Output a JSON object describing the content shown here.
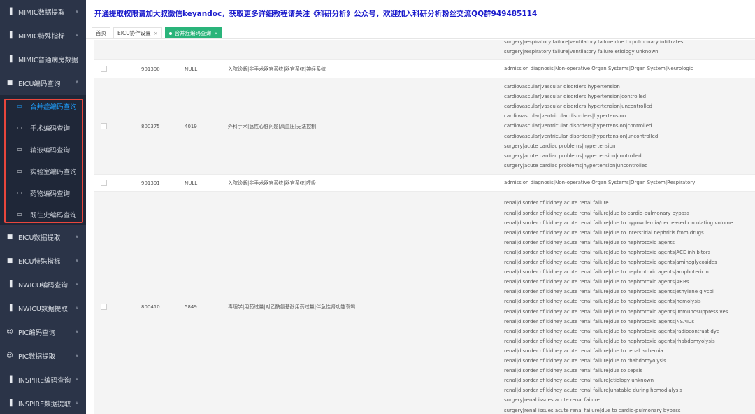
{
  "sidebar": {
    "items": [
      {
        "label": "MIMIC数据提取",
        "icon": "bar-chart-icon",
        "chevron": "∨"
      },
      {
        "label": "MIMIC特殊指标",
        "icon": "bar-chart-icon",
        "chevron": "∨"
      },
      {
        "label": "MIMIC普通病房数据",
        "icon": "bar-chart-icon",
        "chevron": "∨"
      },
      {
        "label": "EICU编码查询",
        "icon": "folder-icon",
        "chevron": "∧"
      }
    ],
    "sub_items": [
      {
        "label": "合并症编码查询",
        "icon": "monitor-icon"
      },
      {
        "label": "手术编码查询",
        "icon": "monitor-icon"
      },
      {
        "label": "输液编码查询",
        "icon": "monitor-icon"
      },
      {
        "label": "实验室编码查询",
        "icon": "monitor-icon"
      },
      {
        "label": "药物编码查询",
        "icon": "monitor-icon"
      },
      {
        "label": "既往史编码查询",
        "icon": "monitor-icon"
      }
    ],
    "items_after": [
      {
        "label": "EICU数据提取",
        "icon": "folder-icon",
        "chevron": "∨"
      },
      {
        "label": "EICU特殊指标",
        "icon": "folder-icon",
        "chevron": "∨"
      },
      {
        "label": "NWICU编码查询",
        "icon": "bar-chart-icon",
        "chevron": "∨"
      },
      {
        "label": "NWICU数据提取",
        "icon": "bar-chart-icon",
        "chevron": "∨"
      },
      {
        "label": "PIC编码查询",
        "icon": "baby-icon",
        "chevron": "∨"
      },
      {
        "label": "PIC数据提取",
        "icon": "baby-icon",
        "chevron": "∨"
      },
      {
        "label": "INSPIRE编码查询",
        "icon": "bar-chart-icon",
        "chevron": "∨"
      },
      {
        "label": "INSPIRE数据提取",
        "icon": "bar-chart-icon",
        "chevron": "∨"
      }
    ]
  },
  "banner": "开通提取权限请加大叔微信keyandoc，获取更多详细教程请关注《科研分析》公众号，欢迎加入科研分析粉丝交流QQ群949485114",
  "tabs": {
    "home": "首页",
    "eicu_settings": "EICU协作设置",
    "active": "合并症编码查询",
    "close": "×"
  },
  "rows": [
    {
      "id": "",
      "code": "",
      "cn": "",
      "en": [
        "surgery|respiratory failure|ventilatory failure|due to pulmonary infiltrates",
        "surgery|respiratory failure|ventilatory failure|etiology unknown"
      ]
    },
    {
      "id": "901390",
      "code": "NULL",
      "cn": "入院诊断|非手术器官系统|器官系统|神经系统",
      "en": [
        "admission diagnosis|Non-operative Organ Systems|Organ System|Neurologic"
      ]
    },
    {
      "id": "800375",
      "code": "4019",
      "cn": "外科手术|急性心脏问题|高血压|无法控制",
      "en": [
        "cardiovascular|vascular disorders|hypertension",
        "cardiovascular|vascular disorders|hypertension|controlled",
        "cardiovascular|vascular disorders|hypertension|uncontrolled",
        "cardiovascular|ventricular disorders|hypertension",
        "cardiovascular|ventricular disorders|hypertension|controlled",
        "cardiovascular|ventricular disorders|hypertension|uncontrolled",
        "surgery|acute cardiac problems|hypertension",
        "surgery|acute cardiac problems|hypertension|controlled",
        "surgery|acute cardiac problems|hypertension|uncontrolled"
      ]
    },
    {
      "id": "901391",
      "code": "NULL",
      "cn": "入院诊断|非手术器官系统|器官系统|呼吸",
      "en": [
        "admission diagnosis|Non-operative Organ Systems|Organ System|Respiratory"
      ]
    },
    {
      "id": "800410",
      "code": "5849",
      "cn": "毒理学|用药过量|对乙酰氨基酚用药过量|伴急性肾功能衰竭",
      "en": [
        "renal|disorder of kidney|acute renal failure",
        "renal|disorder of kidney|acute renal failure|due to cardio-pulmonary bypass",
        "renal|disorder of kidney|acute renal failure|due to hypovolemia/decreased circulating volume",
        "renal|disorder of kidney|acute renal failure|due to interstitial nephritis from drugs",
        "renal|disorder of kidney|acute renal failure|due to nephrotoxic agents",
        "renal|disorder of kidney|acute renal failure|due to nephrotoxic agents|ACE inhibitors",
        "renal|disorder of kidney|acute renal failure|due to nephrotoxic agents|aminoglycosides",
        "renal|disorder of kidney|acute renal failure|due to nephrotoxic agents|amphotericin",
        "renal|disorder of kidney|acute renal failure|due to nephrotoxic agents|ARBs",
        "renal|disorder of kidney|acute renal failure|due to nephrotoxic agents|ethylene glycol",
        "renal|disorder of kidney|acute renal failure|due to nephrotoxic agents|hemolysis",
        "renal|disorder of kidney|acute renal failure|due to nephrotoxic agents|immunosuppressives",
        "renal|disorder of kidney|acute renal failure|due to nephrotoxic agents|NSAIDs",
        "renal|disorder of kidney|acute renal failure|due to nephrotoxic agents|radiocontrast dye",
        "renal|disorder of kidney|acute renal failure|due to nephrotoxic agents|rhabdomyolysis",
        "renal|disorder of kidney|acute renal failure|due to renal ischemia",
        "renal|disorder of kidney|acute renal failure|due to rhabdomyolysis",
        "renal|disorder of kidney|acute renal failure|due to sepsis",
        "renal|disorder of kidney|acute renal failure|etiology unknown",
        "renal|disorder of kidney|acute renal failure|unstable during hemodialysis",
        "surgery|renal issues|acute renal failure",
        "surgery|renal issues|acute renal failure|due to cardio-pulmonary bypass"
      ]
    }
  ]
}
